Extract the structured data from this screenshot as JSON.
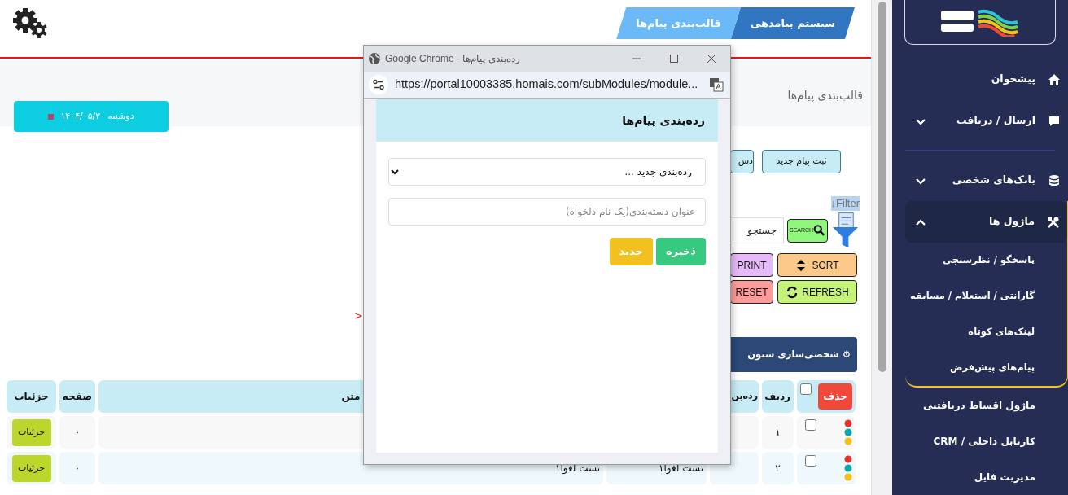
{
  "header": {
    "breadcrumb": [
      {
        "label": "سیستم پیامدهی",
        "selected": false
      },
      {
        "label": "قالب‌بندی پیام‌ها",
        "selected": true
      }
    ]
  },
  "page": {
    "title": "قالب‌بندی پیام‌ها",
    "date_button": "دوشنبه ۱۴۰۴/۰۵/۲۰"
  },
  "toolbar": {
    "buttons": [
      "ثبت پیام جدید",
      "دس"
    ],
    "filter_link": "↓Filter",
    "search": {
      "placeholder": "جستجو",
      "button": "SEARCH"
    },
    "actions": [
      {
        "label": "SORT",
        "kind": "sort"
      },
      {
        "label": "PRINT",
        "kind": "print"
      },
      {
        "label": "REFRESH",
        "kind": "refresh"
      },
      {
        "label": "RESET",
        "kind": "reset"
      }
    ],
    "pager_arrow": "<",
    "customize_button": "⚙ شخصی‌سازی ستون"
  },
  "table": {
    "delete_button": "حذف",
    "all_checked": false,
    "columns": [
      "ردیف",
      "رده‌بن",
      null,
      "متن",
      "صفحه",
      "جزئیات"
    ],
    "rows": [
      {
        "checked": false,
        "row_no": "۱",
        "page": "۰",
        "details": "جزئیات"
      },
      {
        "checked": false,
        "row_no": "۲",
        "column_4": "تست لغوا۱",
        "text": "تست لغوا۱",
        "page": "۰",
        "details": "جزئیات"
      }
    ]
  },
  "popup": {
    "window_title": "Google Chrome - رده‌بندی پیام‌ها",
    "url": "https://portal10003385.homais.com/subModules/module...",
    "heading": "رده‌بندی پیام‌ها",
    "select_value": "رده‌بندی جدید ...",
    "name_placeholder": "عنوان دسته‌بندی(یک نام دلخواه)",
    "buttons": [
      {
        "label": "ذخیره",
        "kind": "save"
      },
      {
        "label": "جدید",
        "kind": "new"
      }
    ]
  },
  "sidebar": {
    "items": [
      {
        "label": "پیشخوان",
        "kind": "link",
        "divider_above": false
      },
      {
        "label": "ارسال / دریافت",
        "kind": "group",
        "expanded": false,
        "divider_above": false
      },
      {
        "label": "بانک‌های شخصی",
        "kind": "group",
        "expanded": false,
        "divider_above": true
      },
      {
        "label": "ماژول ها",
        "kind": "group",
        "expanded": true,
        "divider_above": false,
        "children": [
          {
            "label": "پاسخگو / نظرسنجی"
          },
          {
            "label": "گارانتی / استعلام / مسابقه"
          },
          {
            "label": "لینک‌های کوتاه"
          },
          {
            "label": "پیام‌های پیش‌فرض"
          }
        ]
      },
      {
        "label": "ماژول اقساط دریافتنی",
        "kind": "plain",
        "divider_above": false
      },
      {
        "label": "کارتابل داخلی / CRM",
        "kind": "plain",
        "divider_above": false
      },
      {
        "label": "مدیریت فایل",
        "kind": "plain",
        "divider_above": false
      }
    ]
  }
}
